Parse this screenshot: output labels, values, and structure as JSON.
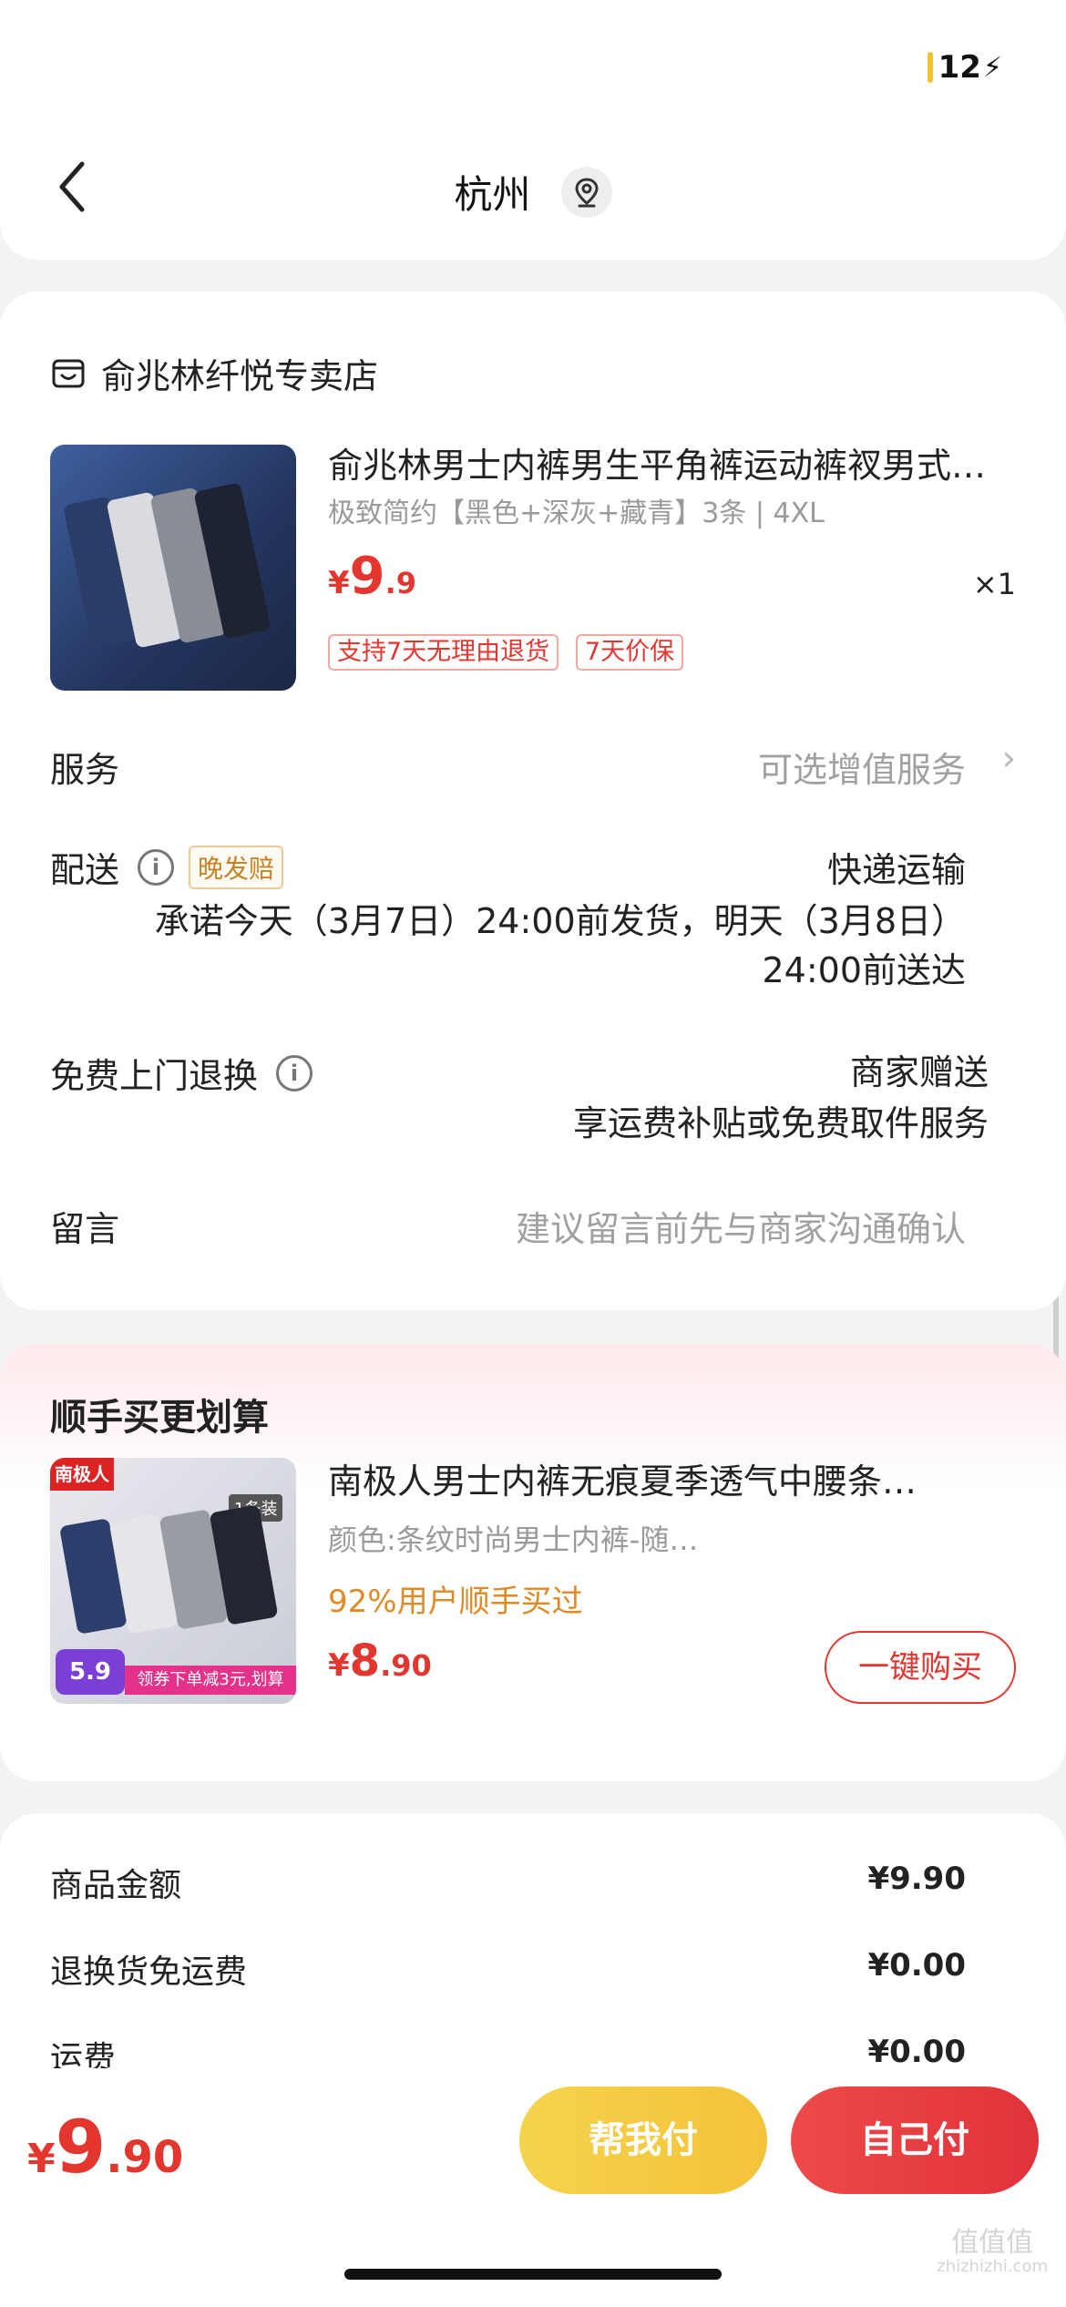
{
  "status": {
    "battery": "12"
  },
  "header": {
    "title": "杭州"
  },
  "shop": {
    "name": "俞兆林纤悦专卖店"
  },
  "product": {
    "name": "俞兆林男士内裤男生平角裤运动裤衩男式…",
    "spec": "极致简约【黑色+深灰+藏青】3条 | 4XL",
    "price_yen": "¥",
    "price_int": "9",
    "price_dec": ".9",
    "qty": "×1",
    "tags": [
      "支持7天无理由退货",
      "7天价保"
    ]
  },
  "rows": {
    "service_label": "服务",
    "service_value": "可选增值服务",
    "delivery_label": "配送",
    "delivery_badge": "晚发赔",
    "delivery_method": "快递运输",
    "delivery_line1": "承诺今天（3月7日）24:00前发货，明天（3月8日）",
    "delivery_line2": "24:00前送达",
    "return_label": "免费上门退换",
    "return_line1": "商家赠送",
    "return_line2": "享运费补贴或免费取件服务",
    "note_label": "留言",
    "note_placeholder": "建议留言前先与商家沟通确认"
  },
  "recommend": {
    "title": "顺手买更划算",
    "name": "南极人男士内裤无痕夏季透气中腰条…",
    "spec": "颜色:条纹时尚男士内裤-随…",
    "percent": "92%用户顺手买过",
    "price_yen": "¥",
    "price_int": "8",
    "price_dec": ".90",
    "buy_label": "一键购买",
    "thumb_brand": "南极人",
    "thumb_pack": "1条装",
    "thumb_price": "5.9",
    "thumb_coupon": "领券下单减3元,划算"
  },
  "summary": [
    {
      "label": "商品金额",
      "value": "¥9.90"
    },
    {
      "label": "退换货免运费",
      "value": "¥0.00"
    },
    {
      "label": "运费",
      "value": "¥0.00"
    }
  ],
  "bottom": {
    "total_yen": "¥",
    "total_int": "9",
    "total_dec": ".90",
    "helper_label": "帮我付",
    "self_label": "自己付"
  },
  "watermark": {
    "main": "值值值",
    "sub": "zhizhizhi.com"
  },
  "colors": {
    "accent_red": "#e2362f",
    "gold": "#f4c339",
    "orange": "#e08a26"
  }
}
